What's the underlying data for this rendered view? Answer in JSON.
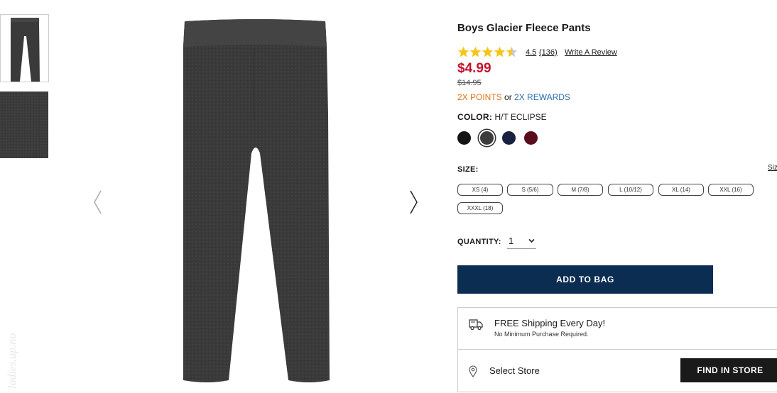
{
  "product": {
    "title": "Boys Glacier Fleece Pants",
    "rating": {
      "score_text": "4.5",
      "count_text": "(136)",
      "stars_value": 4.5,
      "stars_max": 5,
      "write_review": "Write A Review"
    },
    "price": "$4.99",
    "original_price": "$14.95",
    "points": {
      "points_text": "2X POINTS",
      "or_text": " or ",
      "rewards_text": "2X REWARDS"
    }
  },
  "color": {
    "label": "COLOR:",
    "value": "H/T ECLIPSE",
    "swatches": [
      {
        "name": "black",
        "hex": "#141414",
        "selected": false
      },
      {
        "name": "h/t eclipse",
        "hex": "#3c3c3c",
        "selected": true
      },
      {
        "name": "navy",
        "hex": "#18213f",
        "selected": false
      },
      {
        "name": "burgundy",
        "hex": "#5a0d1c",
        "selected": false
      }
    ]
  },
  "size": {
    "label": "SIZE:",
    "chart_link": "Siz",
    "options": [
      "XS (4)",
      "S (5/6)",
      "M (7/8)",
      "L (10/12)",
      "XL (14)",
      "XXL (16)",
      "XXXL (18)"
    ]
  },
  "quantity": {
    "label": "QUANTITY:",
    "value": "1"
  },
  "add_to_bag": "ADD TO BAG",
  "shipping": {
    "title": "FREE Shipping Every Day!",
    "subtitle": "No Minimum Purchase Required."
  },
  "store": {
    "select_label": "Select Store",
    "find_button": "FIND IN STORE"
  },
  "watermark": "ladies.ap.no",
  "colors": {
    "price_red": "#c4122f",
    "points_orange": "#e2731b",
    "rewards_blue": "#2e6ea7",
    "primary_navy": "#0b2d52",
    "star_gold": "#f5c518",
    "pants_gray": "#3a3a3a"
  }
}
